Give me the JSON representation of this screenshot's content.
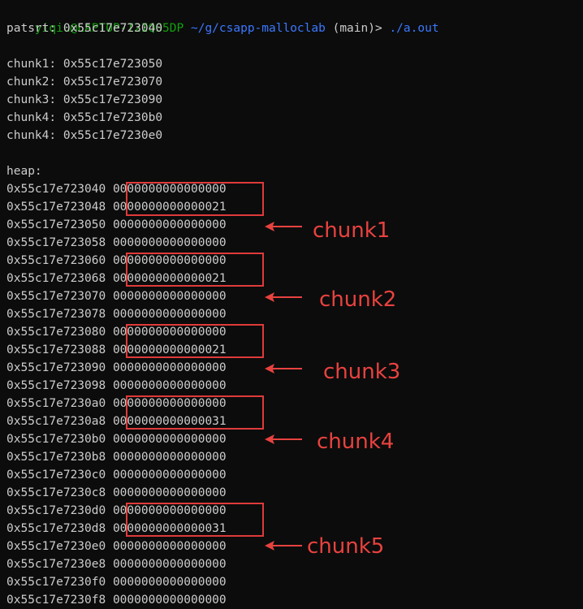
{
  "prompt": {
    "user_host": "yiqiu@LAPTOP-I2IQS5DP",
    "path": "~/g/csapp-malloclab",
    "branch": "(main)>",
    "command": "./a.out"
  },
  "output": {
    "patsrt": "patsrt: 0x55c17e723040",
    "chunks": [
      "chunk1: 0x55c17e723050",
      "chunk2: 0x55c17e723070",
      "chunk3: 0x55c17e723090",
      "chunk4: 0x55c17e7230b0",
      "chunk4: 0x55c17e7230e0"
    ],
    "heap_title": "heap:",
    "heap_rows": [
      {
        "addr": "0x55c17e723040",
        "value": "0000000000000000"
      },
      {
        "addr": "0x55c17e723048",
        "value": "0000000000000021"
      },
      {
        "addr": "0x55c17e723050",
        "value": "0000000000000000"
      },
      {
        "addr": "0x55c17e723058",
        "value": "0000000000000000"
      },
      {
        "addr": "0x55c17e723060",
        "value": "0000000000000000"
      },
      {
        "addr": "0x55c17e723068",
        "value": "0000000000000021"
      },
      {
        "addr": "0x55c17e723070",
        "value": "0000000000000000"
      },
      {
        "addr": "0x55c17e723078",
        "value": "0000000000000000"
      },
      {
        "addr": "0x55c17e723080",
        "value": "0000000000000000"
      },
      {
        "addr": "0x55c17e723088",
        "value": "0000000000000021"
      },
      {
        "addr": "0x55c17e723090",
        "value": "0000000000000000"
      },
      {
        "addr": "0x55c17e723098",
        "value": "0000000000000000"
      },
      {
        "addr": "0x55c17e7230a0",
        "value": "0000000000000000"
      },
      {
        "addr": "0x55c17e7230a8",
        "value": "0000000000000031"
      },
      {
        "addr": "0x55c17e7230b0",
        "value": "0000000000000000"
      },
      {
        "addr": "0x55c17e7230b8",
        "value": "0000000000000000"
      },
      {
        "addr": "0x55c17e7230c0",
        "value": "0000000000000000"
      },
      {
        "addr": "0x55c17e7230c8",
        "value": "0000000000000000"
      },
      {
        "addr": "0x55c17e7230d0",
        "value": "0000000000000000"
      },
      {
        "addr": "0x55c17e7230d8",
        "value": "0000000000000031"
      },
      {
        "addr": "0x55c17e7230e0",
        "value": "0000000000000000"
      },
      {
        "addr": "0x55c17e7230e8",
        "value": "0000000000000000"
      },
      {
        "addr": "0x55c17e7230f0",
        "value": "0000000000000000"
      },
      {
        "addr": "0x55c17e7230f8",
        "value": "0000000000000000"
      }
    ]
  },
  "annotations": {
    "labels": [
      "chunk1",
      "chunk2",
      "chunk3",
      "chunk4",
      "chunk5"
    ],
    "color": "#e8423f"
  },
  "colors": {
    "background": "#0c0c0c",
    "text": "#cccccc",
    "prompt_user": "#13a10e",
    "prompt_path": "#3b78ff",
    "highlight_box": "#e03a3a"
  }
}
